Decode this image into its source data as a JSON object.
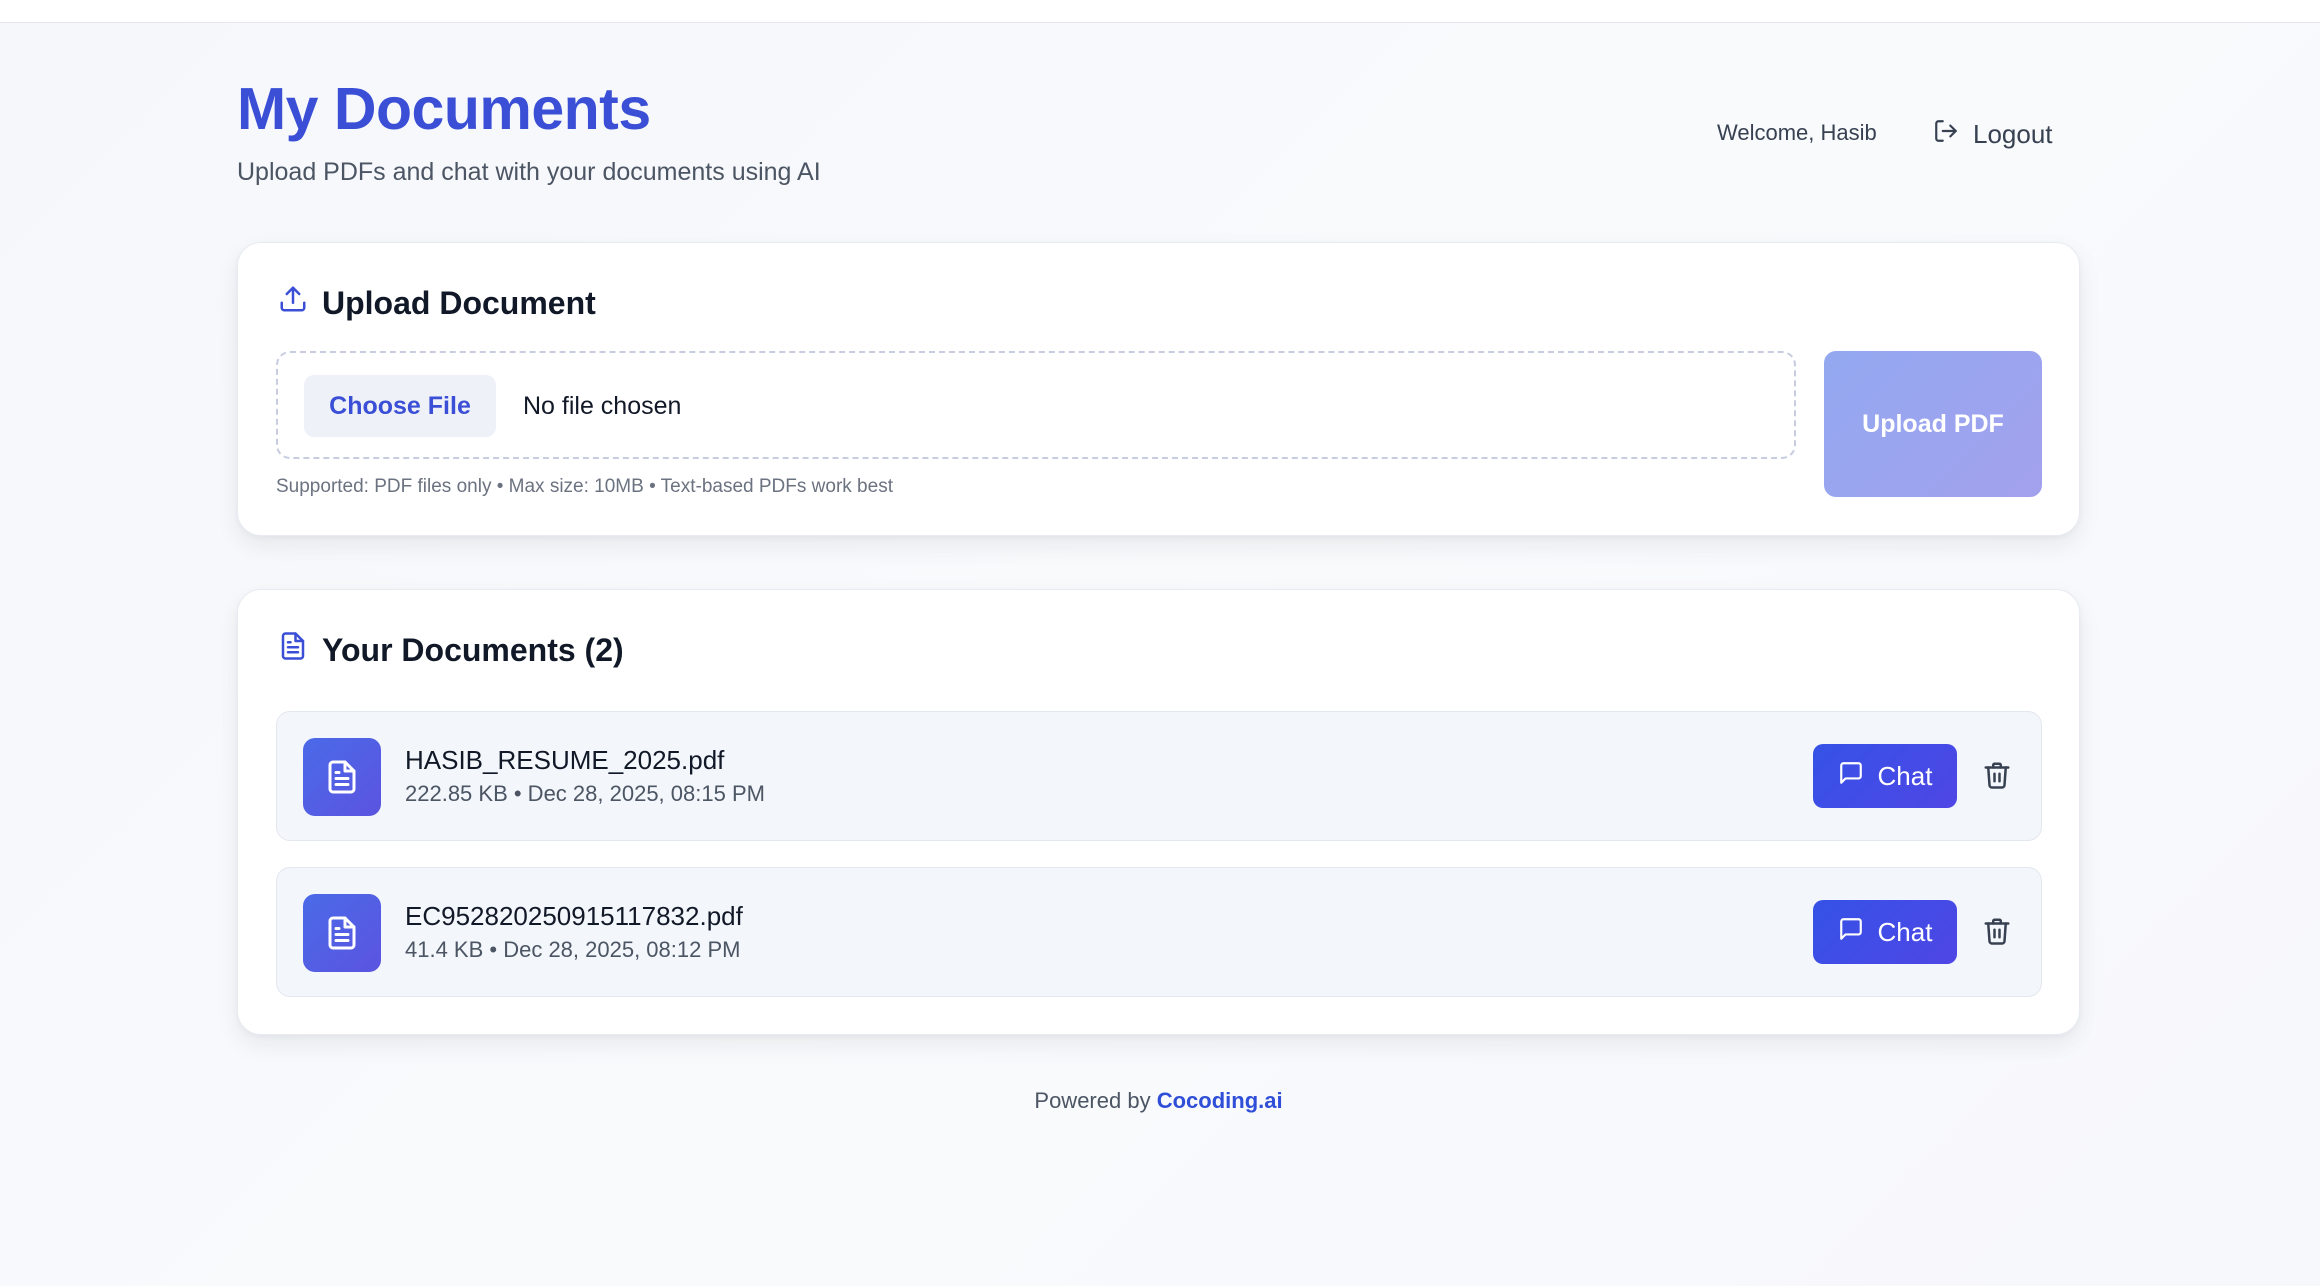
{
  "header": {
    "title": "My Documents",
    "subtitle": "Upload PDFs and chat with your documents using AI",
    "welcome": "Welcome, Hasib",
    "logout_label": "Logout"
  },
  "upload": {
    "title": "Upload Document",
    "choose_file_label": "Choose File",
    "no_file_text": "No file chosen",
    "upload_button_label": "Upload PDF",
    "hint": "Supported: PDF files only • Max size: 10MB • Text-based PDFs work best"
  },
  "documents": {
    "title": "Your Documents (2)",
    "items": [
      {
        "name": "HASIB_RESUME_2025.pdf",
        "meta": "222.85 KB • Dec 28, 2025, 08:15 PM",
        "chat_label": "Chat"
      },
      {
        "name": "EC952820250915117832.pdf",
        "meta": "41.4 KB • Dec 28, 2025, 08:12 PM",
        "chat_label": "Chat"
      }
    ]
  },
  "footer": {
    "prefix": "Powered by",
    "brand": "Cocoding.ai"
  },
  "colors": {
    "accent": "#3b4fd6",
    "upload_button": "#9ba5ef",
    "chat_button": "#3b4fe4",
    "doc_row_bg": "#f3f6fa"
  },
  "icons": {
    "logout": "logout-icon",
    "upload": "upload-icon",
    "documents": "document-icon",
    "file": "file-text-icon",
    "chat": "message-square-icon",
    "delete": "trash-icon"
  }
}
